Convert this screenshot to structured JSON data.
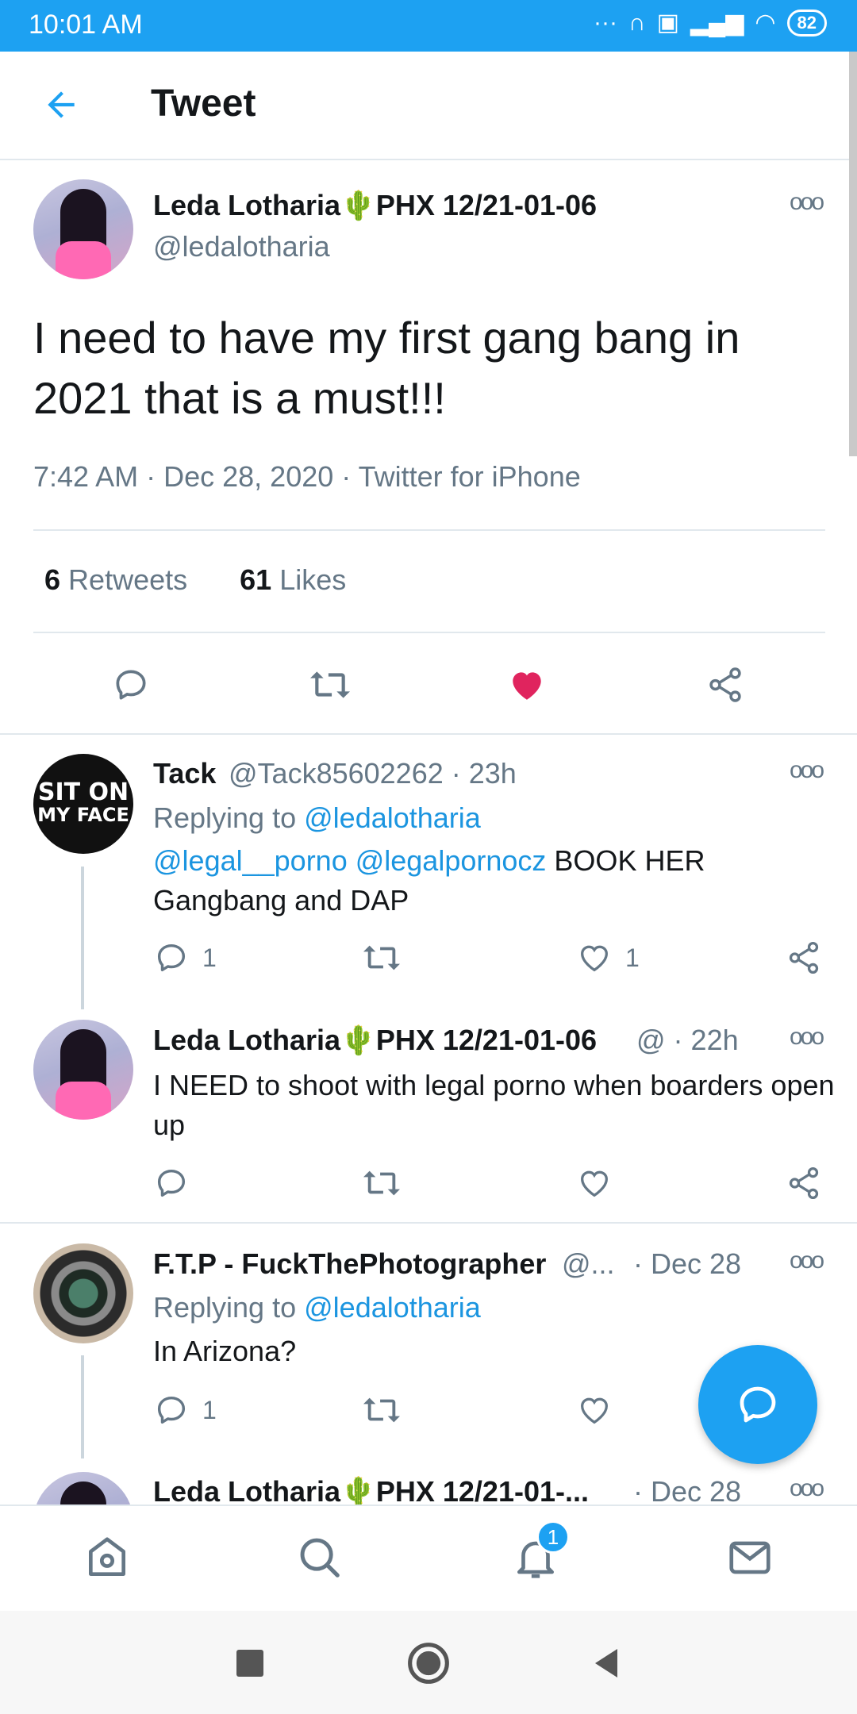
{
  "status_bar": {
    "time": "10:01 AM",
    "battery": "82"
  },
  "header": {
    "title": "Tweet"
  },
  "main_tweet": {
    "name": "Leda Lotharia🌵PHX 12/21-01-06",
    "handle": "@ledalotharia",
    "text": "I need to have my first gang bang in 2021 that is a must!!!",
    "time": "7:42 AM",
    "date": "Dec 28, 2020",
    "source": "Twitter for iPhone",
    "retweets_count": "6",
    "retweets_label": "Retweets",
    "likes_count": "61",
    "likes_label": "Likes",
    "liked": true
  },
  "replies": [
    {
      "name": "Tack",
      "handle": "@Tack85602262",
      "time": "23h",
      "replying_label": "Replying to",
      "replying_to": "@ledalotharia",
      "mentions": "@legal__porno @legalpornocz",
      "text": "BOOK HER",
      "text2": "Gangbang and DAP",
      "avatar_text1": "SIT ON",
      "avatar_text2": "MY FACE",
      "reply_count": "1",
      "like_count": "1"
    },
    {
      "name": "Leda Lotharia🌵PHX 12/21-01-06",
      "handle": "@",
      "time": "22h",
      "text": "I NEED to shoot with legal porno when boarders open up"
    },
    {
      "name": "F.T.P - FuckThePhotographer",
      "handle": "@...",
      "time": "Dec 28",
      "replying_label": "Replying to",
      "replying_to": "@ledalotharia",
      "text": "In Arizona?",
      "reply_count": "1"
    },
    {
      "name": "Leda Lotharia🌵PHX 12/21-01-...",
      "time": "Dec 28"
    }
  ],
  "bottom_nav": {
    "notifications_badge": "1"
  },
  "colors": {
    "accent": "#1da1f2",
    "like": "#e0245e",
    "muted": "#657786"
  }
}
